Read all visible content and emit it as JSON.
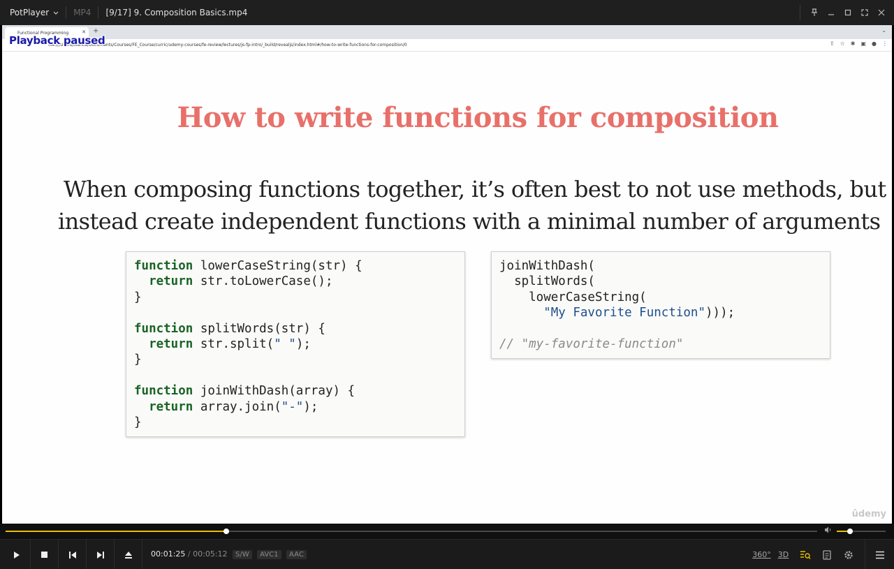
{
  "player": {
    "brand": "PotPlayer",
    "format": "MP4",
    "file_title": "[9/17] 9. Composition Basics.mp4",
    "osd_message": "Playback paused"
  },
  "browser": {
    "tab_title": "Functional Programming",
    "url": "file:///Users/bianca/Documents/Courses/FE_Course/curric/udemy-courses/fe-review/lectures/js-fp-intro/_build/revealjs/index.html#/how-to-write-functions-for-composition/0"
  },
  "slide": {
    "title": "How to write functions for composition",
    "body_line1": "When composing functions together, it’s often best to not use methods, but",
    "body_line2": "instead create independent functions with a minimal number of arguments",
    "code_left": {
      "kw1": "function",
      "l1": " lowerCaseString(str) {",
      "kw2": "return",
      "l2": " str.toLowerCase();",
      "l3": "}",
      "kw4": "function",
      "l4": " splitWords(str) {",
      "kw5": "return",
      "l5a": " str.split(",
      "l5s": "\" \"",
      "l5b": ");",
      "l6": "}",
      "kw7": "function",
      "l7": " joinWithDash(array) {",
      "kw8": "return",
      "l8a": " array.join(",
      "l8s": "\"-\"",
      "l8b": ");",
      "l9": "}"
    },
    "code_right": {
      "r1": "joinWithDash(",
      "r2": "  splitWords(",
      "r3": "    lowerCaseString(",
      "r4s": "\"My Favorite Function\"",
      "r4b": ")));",
      "r5": "// \"my-favorite-function\""
    },
    "watermark": "ûdemy"
  },
  "playback": {
    "current_time": "00:01:25",
    "duration": "00:05:12",
    "progress": 0.272,
    "volume": 0.27,
    "badges": [
      "S/W",
      "AVC1",
      "AAC"
    ],
    "accent": "#e9c200"
  },
  "controls": {
    "right_icons": [
      "360-icon",
      "3d-icon",
      "playlist-search-icon",
      "chapters-icon",
      "settings-icon"
    ],
    "label_360": "360°",
    "label_3d": "3D"
  }
}
